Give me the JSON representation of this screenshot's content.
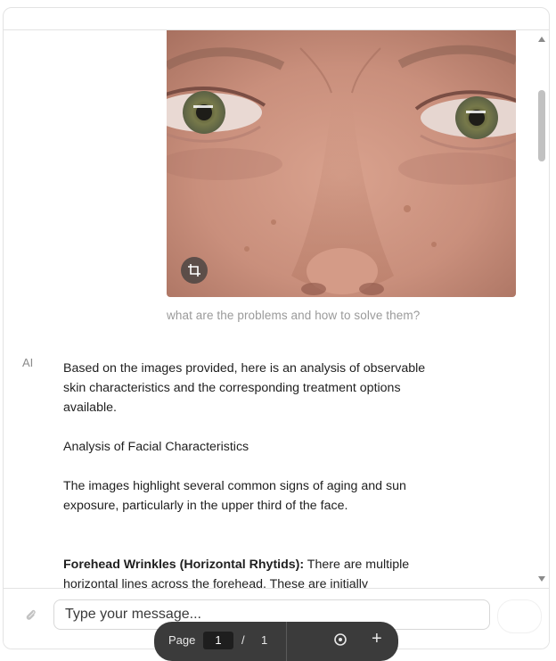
{
  "message": {
    "caption": "what are the problems and how to solve them?",
    "image_alt": "Close-up of the eye and nose area"
  },
  "ai": {
    "label": "AI",
    "paragraphs": [
      "Based on the images provided, here is an analysis of observable skin characteristics and the corresponding treatment options available.",
      "Analysis of Facial Characteristics",
      "The images highlight several common signs of aging and sun exposure, particularly in the upper third of the face."
    ],
    "bold_heading": "Forehead Wrinkles (Horizontal Rhytids):",
    "bold_text": " There are multiple horizontal lines across the forehead. These are initially"
  },
  "composer": {
    "placeholder": "Type your message..."
  },
  "pdf_toolbar": {
    "page_label": "Page",
    "current_page": "1",
    "of_label": "/",
    "total_pages": "1"
  },
  "icons": {
    "crop": "crop-icon",
    "attach": "paperclip-icon",
    "zoom": "zoom-icon",
    "plus": "plus-icon"
  }
}
